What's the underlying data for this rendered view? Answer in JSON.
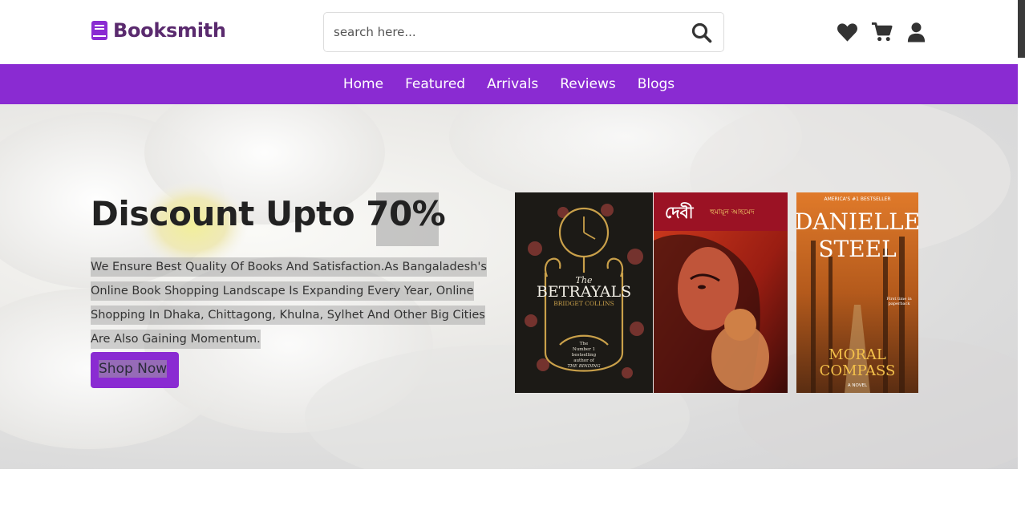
{
  "brand": {
    "name": "Booksmith",
    "icon": "book-icon"
  },
  "search": {
    "placeholder": "search here...",
    "icon": "search-icon"
  },
  "header_icons": [
    "heart-icon",
    "cart-icon",
    "user-icon"
  ],
  "nav": {
    "items": [
      "Home",
      "Featured",
      "Arrivals",
      "Reviews",
      "Blogs"
    ]
  },
  "hero": {
    "title": "Discount Upto 70%",
    "description": "We Ensure Best Quality Of Books And Satisfaction.As Bangaladesh's Online Book Shopping Landscape Is Expanding Every Year, Online Shopping In Dhaka, Chittagong, Khulna, Sylhet And Other Big Cities Are Also Gaining Momentum.",
    "cta": "Shop Now"
  },
  "books": [
    {
      "title": "The BETRAYALS",
      "author": "BRIDGET COLLINS",
      "blurb": "The Number 1 bestselling author of THE BINDING"
    },
    {
      "title": "দেবী",
      "author": "হুমায়ূন আহমেদ"
    },
    {
      "title": "MORAL COMPASS",
      "author": "DANIELLE STEEL",
      "tagline": "AMERICA'S #1 BESTSELLER",
      "note": "First time in paperback",
      "format": "A NOVEL"
    }
  ],
  "colors": {
    "brand": "#8a2bd2",
    "logo_text": "#5a2a6e",
    "icon": "#333333"
  }
}
